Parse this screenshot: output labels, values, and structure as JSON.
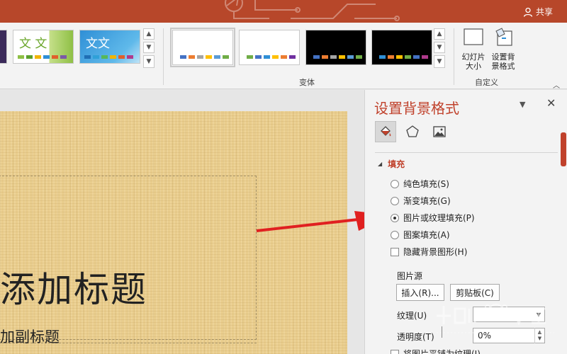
{
  "colors": {
    "titlebar": "#b7472a",
    "accent": "#c0412b",
    "arrow": "#e02020"
  },
  "titlebar": {
    "share_label": "共享",
    "share_icon": "person-icon"
  },
  "ribbon": {
    "themes": [
      {
        "name": "dark-theme"
      },
      {
        "name": "green-theme",
        "sample_text": "文 文"
      },
      {
        "name": "blue-theme",
        "sample_text": "文文"
      }
    ],
    "variants_group_label": "变体",
    "custom_group_label": "自定义",
    "slide_size_label": "幻灯片\n大小",
    "slide_size_arrow": "▾",
    "format_bg_label": "设置背\n景格式"
  },
  "slide": {
    "title": "添加标题",
    "subtitle": "加副标题"
  },
  "pane": {
    "title": "设置背景格式",
    "section": "填充",
    "options": [
      {
        "label": "纯色填充(S)",
        "selected": false
      },
      {
        "label": "渐变填充(G)",
        "selected": false
      },
      {
        "label": "图片或纹理填充(P)",
        "selected": true
      },
      {
        "label": "图案填充(A)",
        "selected": false
      }
    ],
    "hide_bg": "隐藏背景图形(H)",
    "picture_source": "图片源",
    "insert_btn": "插入(R)...",
    "clipboard_btn": "剪贴板(C)",
    "texture_label": "纹理(U)",
    "transparency_label": "透明度(T)",
    "transparency_value": "0%",
    "tile_option": "将图片平铺为纹理(I)"
  }
}
